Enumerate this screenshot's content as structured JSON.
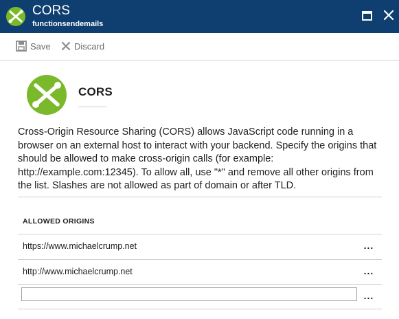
{
  "window": {
    "title": "CORS",
    "subtitle": "functionsendemails"
  },
  "toolbar": {
    "save_label": "Save",
    "discard_label": "Discard"
  },
  "hero": {
    "title": "CORS"
  },
  "description": "Cross-Origin Resource Sharing (CORS) allows JavaScript code running in a browser on an external host to interact with your backend. Specify the origins that should be allowed to make cross-origin calls (for example: http://example.com:12345). To allow all, use \"*\" and remove all other origins from the list. Slashes are not allowed as part of domain or after TLD.",
  "allowed_origins": {
    "heading": "ALLOWED ORIGINS",
    "items": [
      {
        "value": "https://www.michaelcrump.net",
        "menu": "..."
      },
      {
        "value": "http://www.michaelcrump.net",
        "menu": "..."
      }
    ],
    "new_entry": {
      "value": "",
      "placeholder": "",
      "menu": "..."
    }
  },
  "colors": {
    "header_bg": "#0f3f70",
    "brand_green": "#7ab929",
    "toolbar_text": "#6d6d6d"
  },
  "icons": {
    "app_logo": "function-app-icon",
    "maximize": "maximize-icon",
    "close": "close-icon",
    "save": "save-icon",
    "discard": "discard-icon"
  }
}
